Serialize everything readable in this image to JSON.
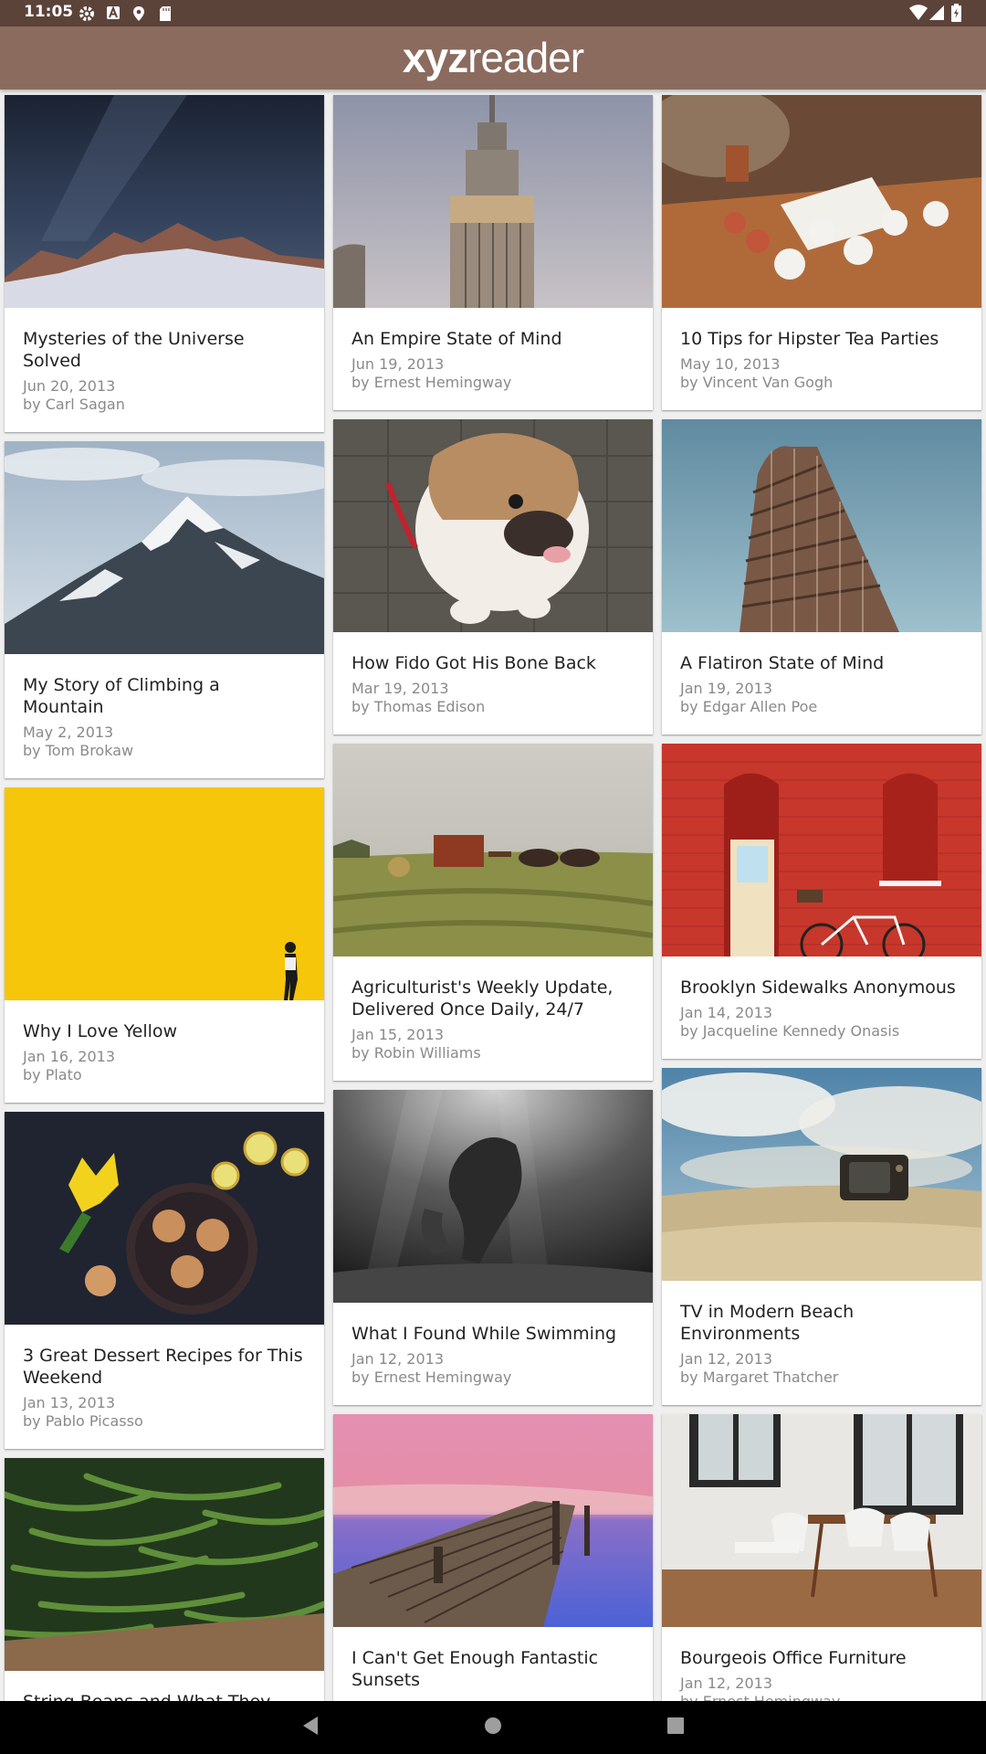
{
  "status_bar": {
    "time": "11:05",
    "left_icons": [
      "settings-gear-icon",
      "a-letter-icon",
      "location-pin-icon",
      "sd-card-icon"
    ],
    "right_icons": [
      "wifi-icon",
      "cellular-signal-icon",
      "battery-icon"
    ]
  },
  "app_bar": {
    "logo_bold": "xyz",
    "logo_regular": "reader",
    "color": "#8b6b5e"
  },
  "articles": [
    {
      "title": "Mysteries of the Universe Solved",
      "date": "Jun 20, 2013",
      "author": "by Carl Sagan",
      "image": "milky-way-over-mountains"
    },
    {
      "title": "An Empire State of Mind",
      "date": "Jun 19, 2013",
      "author": "by Ernest Hemingway",
      "image": "empire-state-building"
    },
    {
      "title": "10 Tips for Hipster Tea Parties",
      "date": "May 10, 2013",
      "author": "by Vincent Van Gogh",
      "image": "tea-cups-on-table"
    },
    {
      "title": "My Story of Climbing a Mountain",
      "date": "May 2, 2013",
      "author": "by Tom Brokaw",
      "image": "snowy-mountain-peak"
    },
    {
      "title": "How Fido Got His Bone Back",
      "date": "Mar 19, 2013",
      "author": "by Thomas Edison",
      "image": "bulldog"
    },
    {
      "title": "A Flatiron State of Mind",
      "date": "Jan 19, 2013",
      "author": "by Edgar Allen Poe",
      "image": "flatiron-building"
    },
    {
      "title": "Why I Love Yellow",
      "date": "Jan 16, 2013",
      "author": "by Plato",
      "image": "yellow-wall-person"
    },
    {
      "title": "Agriculturist's Weekly Update, Delivered Once Daily, 24/7",
      "date": "Jan 15, 2013",
      "author": "by Robin Williams",
      "image": "farm-field-horses"
    },
    {
      "title": "Brooklyn Sidewalks Anonymous",
      "date": "Jan 14, 2013",
      "author": "by Jacqueline Kennedy Onasis",
      "image": "red-brick-wall-bicycle"
    },
    {
      "title": "3 Great Dessert Recipes for This Weekend",
      "date": "Jan 13, 2013",
      "author": "by Pablo Picasso",
      "image": "cookies-and-flowers"
    },
    {
      "title": "What I Found While Swimming",
      "date": "Jan 12, 2013",
      "author": "by Ernest Hemingway",
      "image": "underwater-swimmer"
    },
    {
      "title": "TV in Modern Beach Environments",
      "date": "Jan 12, 2013",
      "author": "by Margaret Thatcher",
      "image": "tv-on-beach"
    },
    {
      "title": "String Beans and What They Mean for You",
      "date": "",
      "author": "",
      "image": "green-beans"
    },
    {
      "title": "I Can't Get Enough Fantastic Sunsets",
      "date": "",
      "author": "",
      "image": "pier-sunset"
    },
    {
      "title": "Bourgeois Office Furniture",
      "date": "Jan 12, 2013",
      "author": "by Ernest Hemingway",
      "image": "dining-chairs-room"
    }
  ],
  "nav_bar": {
    "buttons": [
      "back-icon",
      "home-icon",
      "recents-icon"
    ]
  }
}
